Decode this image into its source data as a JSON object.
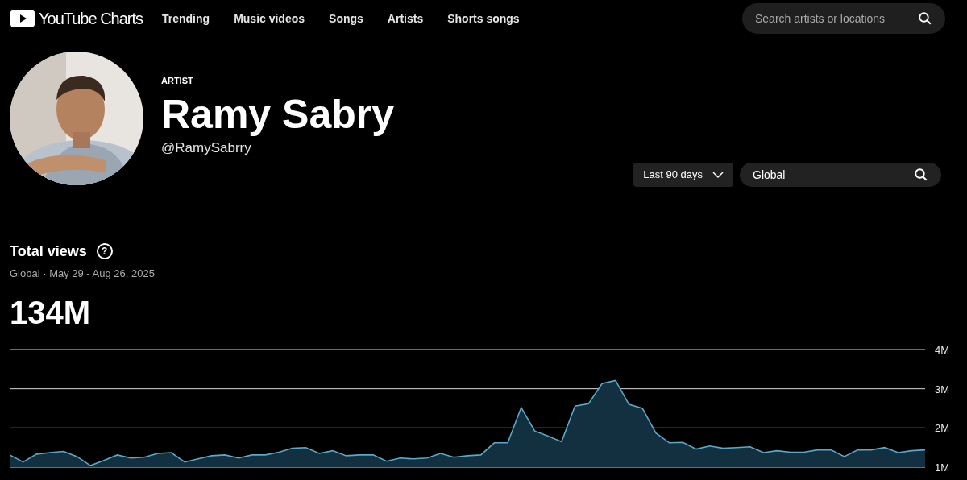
{
  "header": {
    "logo_text": "YouTube Charts",
    "nav": [
      {
        "label": "Trending"
      },
      {
        "label": "Music videos"
      },
      {
        "label": "Songs"
      },
      {
        "label": "Artists"
      },
      {
        "label": "Shorts songs"
      }
    ],
    "search": {
      "placeholder": "Search artists or locations"
    }
  },
  "artist": {
    "eyebrow": "ARTIST",
    "name": "Ramy Sabry",
    "handle": "@RamySabrry"
  },
  "filters": {
    "period": "Last 90 days",
    "location": "Global"
  },
  "stats": {
    "title": "Total views",
    "help": "?",
    "subtitle": "Global · May 29 - Aug 26, 2025",
    "total": "134M"
  },
  "chart_data": {
    "type": "area",
    "ylim": [
      1,
      4
    ],
    "yticks": [
      {
        "value": 4,
        "label": "4M"
      },
      {
        "value": 3,
        "label": "3M"
      },
      {
        "value": 2,
        "label": "2M"
      },
      {
        "value": 1,
        "label": "1M"
      }
    ],
    "series": [
      {
        "color": "#5ba8c8",
        "values": [
          1.31,
          1.13,
          1.33,
          1.37,
          1.4,
          1.27,
          1.04,
          1.17,
          1.31,
          1.23,
          1.25,
          1.35,
          1.37,
          1.13,
          1.21,
          1.29,
          1.31,
          1.23,
          1.31,
          1.31,
          1.38,
          1.48,
          1.5,
          1.35,
          1.42,
          1.29,
          1.31,
          1.31,
          1.15,
          1.23,
          1.21,
          1.23,
          1.35,
          1.25,
          1.29,
          1.31,
          1.62,
          1.62,
          2.52,
          1.92,
          1.79,
          1.65,
          2.56,
          2.62,
          3.13,
          3.21,
          2.6,
          2.5,
          1.87,
          1.62,
          1.63,
          1.46,
          1.54,
          1.48,
          1.5,
          1.52,
          1.37,
          1.42,
          1.38,
          1.38,
          1.44,
          1.44,
          1.27,
          1.44,
          1.44,
          1.5,
          1.37,
          1.42,
          1.44
        ]
      }
    ]
  }
}
